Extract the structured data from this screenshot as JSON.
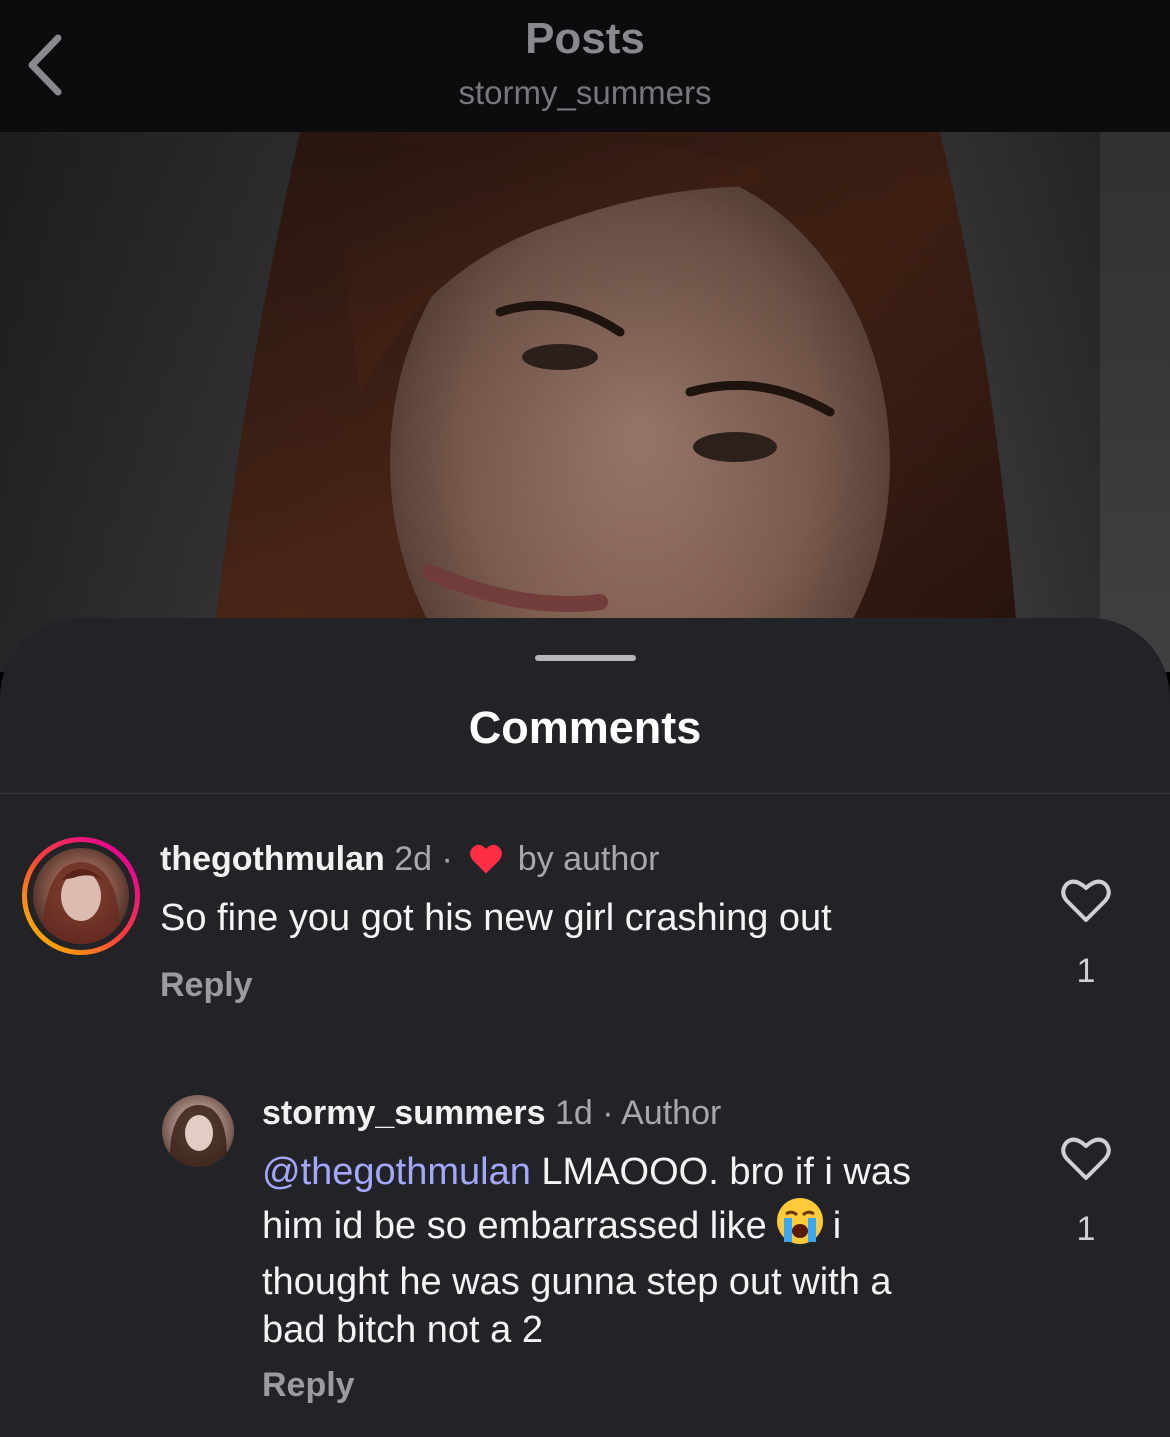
{
  "header": {
    "title": "Posts",
    "subtitle": "stormy_summers"
  },
  "icons": {
    "back": "chevron-left-icon",
    "like": "heart-outline-icon",
    "liked_by_author": "heart-filled-icon",
    "emoji": "loudly-crying-face-emoji"
  },
  "colors": {
    "sheet_bg": "#222327",
    "mention": "#a4a6ff",
    "author_heart": "#ff2d45",
    "story_ring_start": "#ffb400",
    "story_ring_end": "#e1009a"
  },
  "comments_sheet": {
    "title": "Comments"
  },
  "comments": [
    {
      "username": "thegothmulan",
      "time": "2d",
      "separator": "·",
      "liked_label": "by author",
      "text": "So fine you got his new girl crashing out",
      "reply_label": "Reply",
      "like_count": "1"
    },
    {
      "username": "stormy_summers",
      "time": "1d",
      "separator": "·",
      "author_label": "Author",
      "mention": "@thegothmulan",
      "text_line1_rest": " LMAOOO. bro if i was",
      "text_line2_before_emoji": "him id be so embarrassed like",
      "text_line2_after_emoji": "i",
      "text_line3": "thought he was gunna step out with a",
      "text_line4": "bad bitch not a 2",
      "reply_label": "Reply",
      "like_count": "1"
    }
  ]
}
